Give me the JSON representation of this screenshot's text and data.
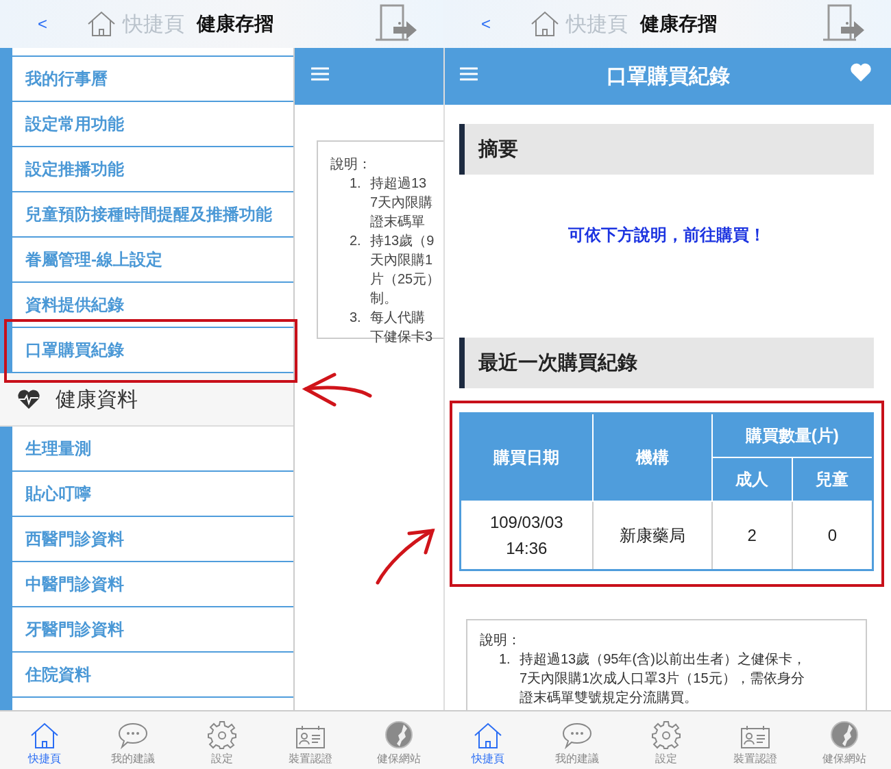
{
  "screens": [
    {
      "kind": "menu",
      "header": {
        "back": "<",
        "home_label": "快捷頁",
        "title": "健康存摺"
      },
      "menu": [
        {
          "kind": "item",
          "label": "我的行事曆",
          "highlighted": false
        },
        {
          "kind": "item",
          "label": "設定常用功能",
          "highlighted": false
        },
        {
          "kind": "item",
          "label": "設定推播功能",
          "highlighted": false
        },
        {
          "kind": "item",
          "label": "兒童預防接種時間提醒及推播功能",
          "highlighted": false
        },
        {
          "kind": "item",
          "label": "眷屬管理-線上設定",
          "highlighted": false
        },
        {
          "kind": "item",
          "label": "資料提供紀錄",
          "highlighted": false
        },
        {
          "kind": "item",
          "label": "口罩購買紀錄",
          "highlighted": true
        },
        {
          "kind": "section",
          "label": "健康資料"
        },
        {
          "kind": "item",
          "label": "生理量測",
          "highlighted": false
        },
        {
          "kind": "item",
          "label": "貼心叮嚀",
          "highlighted": false
        },
        {
          "kind": "item",
          "label": "西醫門診資料",
          "highlighted": false
        },
        {
          "kind": "item",
          "label": "中醫門診資料",
          "highlighted": false
        },
        {
          "kind": "item",
          "label": "牙醫門診資料",
          "highlighted": false
        },
        {
          "kind": "item",
          "label": "住院資料",
          "highlighted": false
        }
      ],
      "note": {
        "title": "說明：",
        "items": [
          {
            "number": "1.",
            "lines": [
              "持超過13",
              "7天內限購",
              "證末碼單"
            ]
          },
          {
            "number": "2.",
            "lines": [
              "持13歲（9",
              "天內限購1",
              "片（25元）",
              "制。"
            ]
          },
          {
            "number": "3.",
            "lines": [
              "每人代購",
              "下健保卡3"
            ]
          }
        ]
      },
      "tabs": [
        {
          "kind": "home",
          "label": "快捷頁",
          "selected": true
        },
        {
          "kind": "chat",
          "label": "我的建議",
          "selected": false
        },
        {
          "kind": "settings",
          "label": "設定",
          "selected": false
        },
        {
          "kind": "card",
          "label": "裝置認證",
          "selected": false
        },
        {
          "kind": "globe",
          "label": "健保網站",
          "selected": false
        }
      ]
    },
    {
      "kind": "record",
      "header": {
        "back": "<",
        "home_label": "快捷頁",
        "title": "健康存摺"
      },
      "bar_title": "口罩購買紀錄",
      "summary": {
        "heading": "摘要",
        "message": "可依下方說明，前往購買！"
      },
      "recent": {
        "heading": "最近一次購買紀錄",
        "highlighted": true,
        "table": {
          "header_rows": [
            [
              {
                "text": "購買日期",
                "rowspan": 2
              },
              {
                "text": "機構",
                "rowspan": 2
              },
              {
                "text": "購買數量(片)",
                "colspan": 2
              }
            ],
            [
              {
                "text": "成人"
              },
              {
                "text": "兒童"
              }
            ]
          ],
          "rows": [
            [
              "109/03/03 14:36",
              "新康藥局",
              "2",
              "0"
            ]
          ]
        }
      },
      "note": {
        "title": "說明：",
        "items": [
          {
            "number": "1.",
            "lines": [
              "持超過13歲（95年(含)以前出生者）之健保卡，",
              "7天內限購1次成人口罩3片（15元），需依身分",
              "證末碼單雙號規定分流購買。"
            ]
          }
        ]
      },
      "tabs": [
        {
          "kind": "home",
          "label": "快捷頁",
          "selected": true
        },
        {
          "kind": "chat",
          "label": "我的建議",
          "selected": false
        },
        {
          "kind": "settings",
          "label": "設定",
          "selected": false
        },
        {
          "kind": "card",
          "label": "裝置認證",
          "selected": false
        },
        {
          "kind": "globe",
          "label": "健保網站",
          "selected": false
        }
      ]
    }
  ]
}
